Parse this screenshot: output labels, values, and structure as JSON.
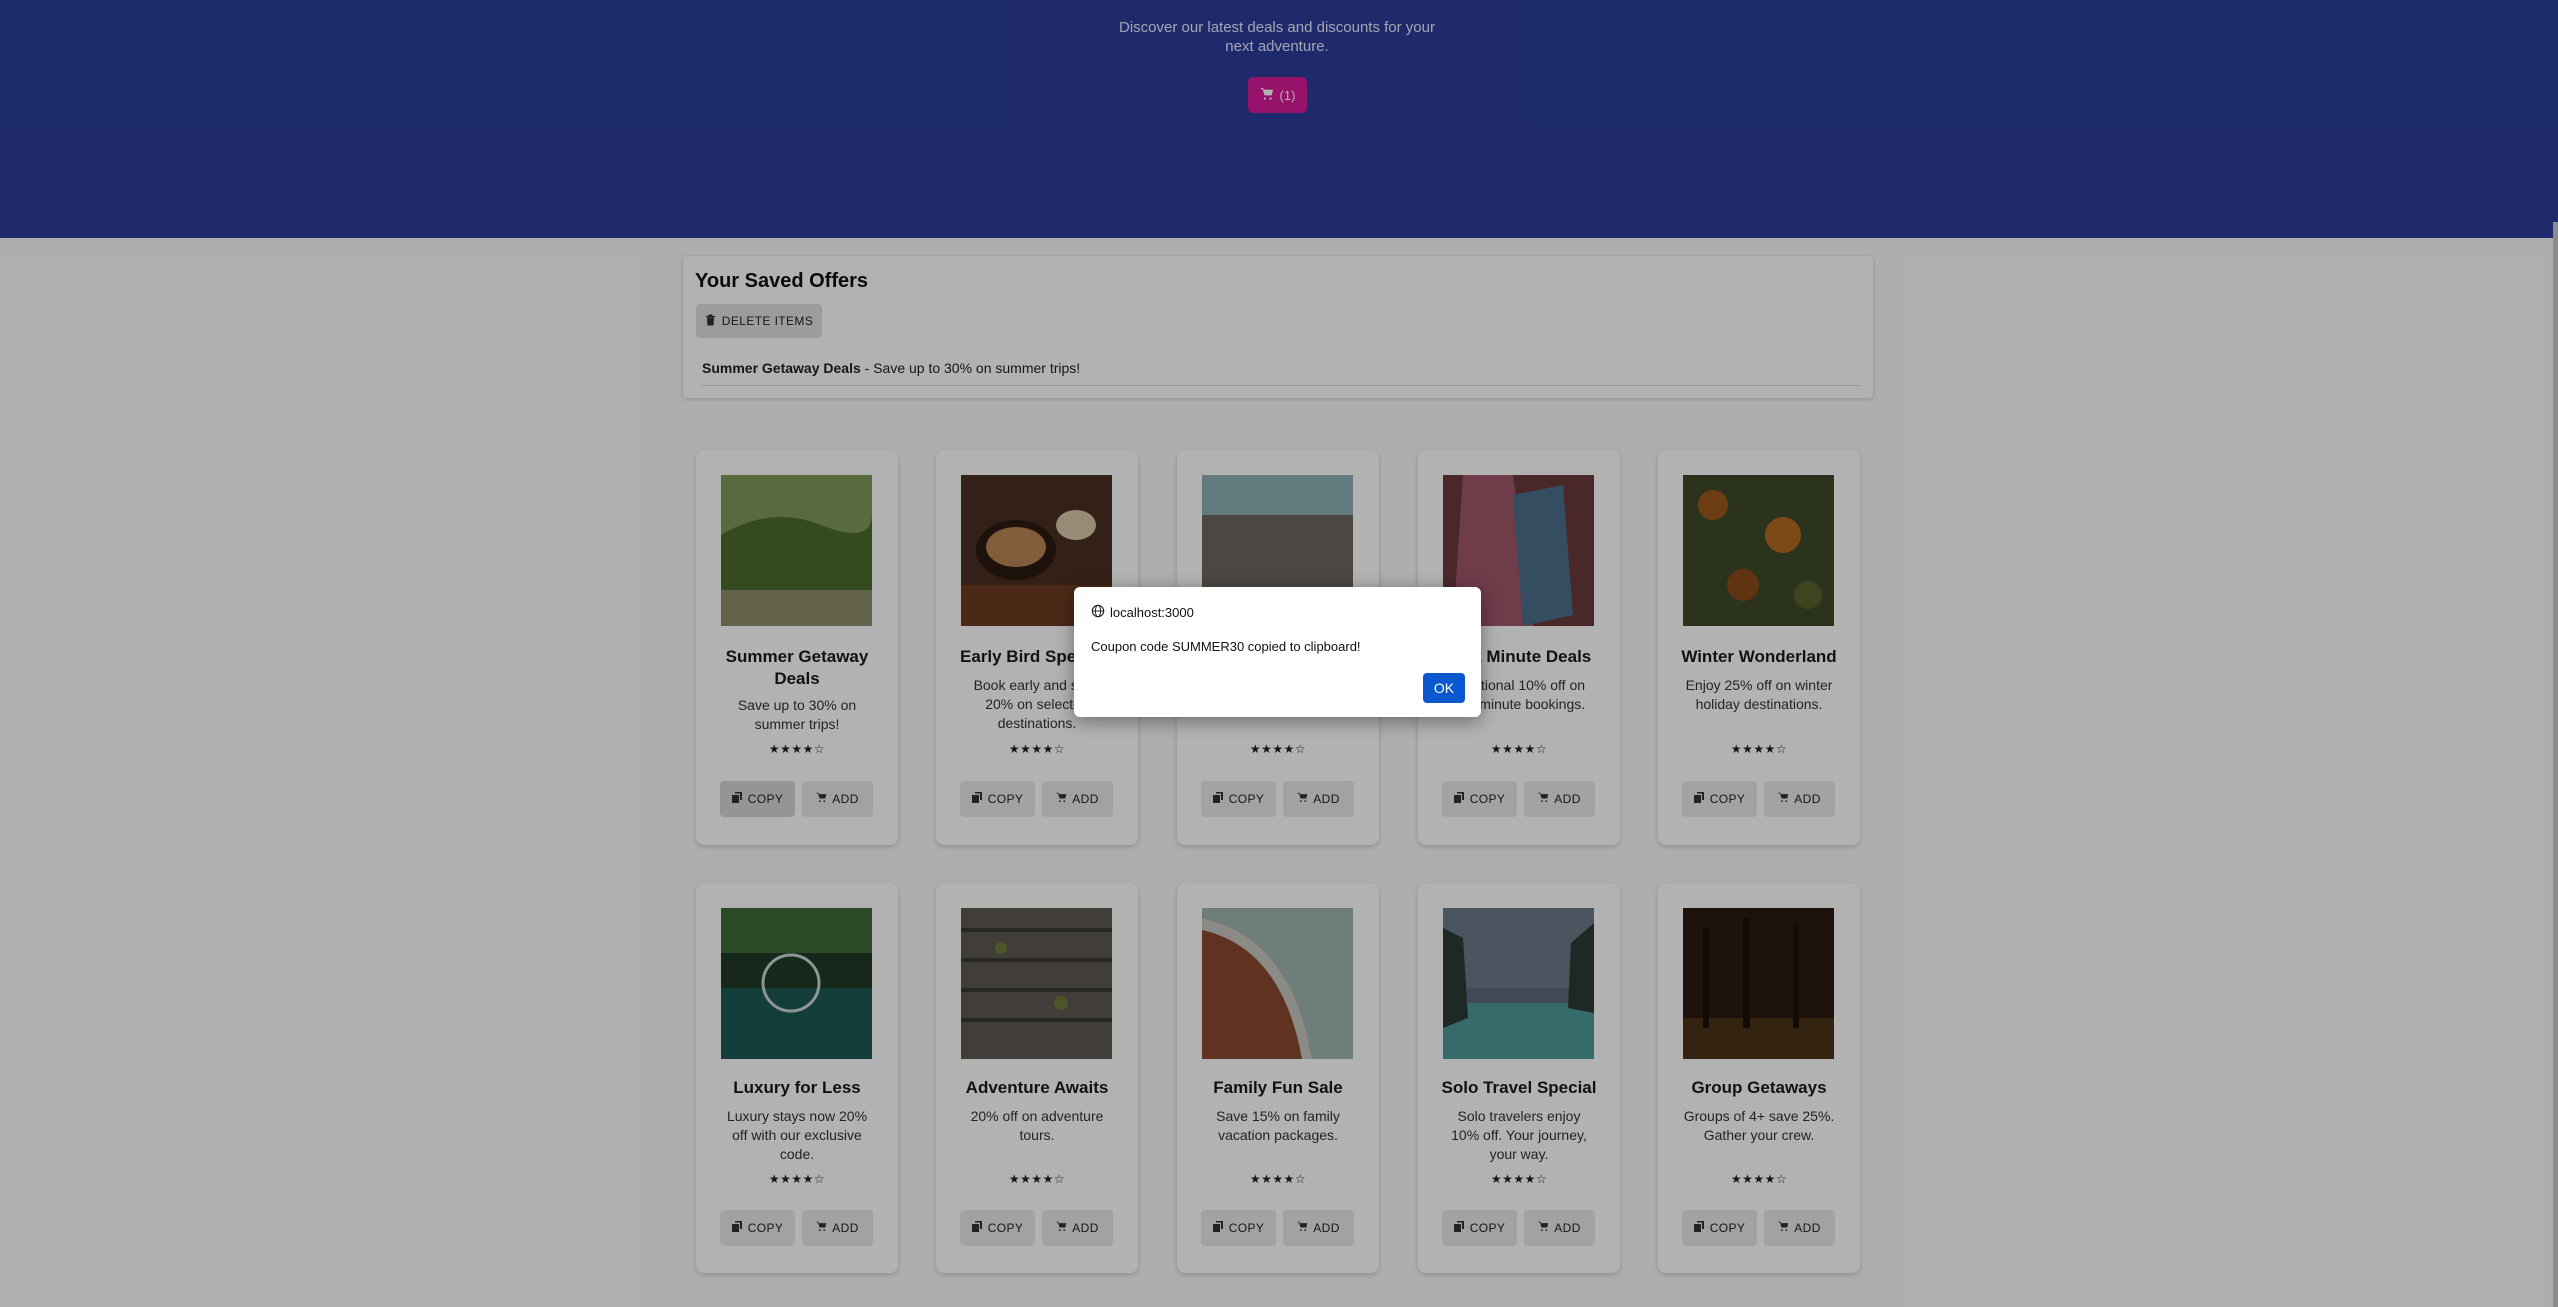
{
  "hero": {
    "subtitle": "Discover our latest deals and discounts for your next adventure.",
    "cart_label": "(1)",
    "cart_icon": "cart-icon",
    "background": "#2b3d9a",
    "cart_color": "#d81b9a"
  },
  "saved": {
    "title": "Your Saved Offers",
    "delete_label": "DELETE ITEMS",
    "item_name": "Summer Getaway Deals",
    "item_desc": " - Save up to 30% on summer trips!"
  },
  "card_buttons": {
    "copy": "COPY",
    "add": "ADD"
  },
  "cards": [
    {
      "title": "Summer Getaway Deals",
      "desc": "Save up to 30% on summer trips!",
      "stars": "★★★★☆",
      "rating": 4
    },
    {
      "title": "Early Bird Specials",
      "desc": "Book early and save 20% on selected destinations.",
      "stars": "★★★★☆",
      "rating": 4
    },
    {
      "title": "",
      "desc": "",
      "stars": "★★★★☆",
      "rating": 4
    },
    {
      "title": "Last Minute Deals",
      "desc": "Additional 10% off on last-minute bookings.",
      "stars": "★★★★☆",
      "rating": 4
    },
    {
      "title": "Winter Wonderland",
      "desc": "Enjoy 25% off on winter holiday destinations.",
      "stars": "★★★★☆",
      "rating": 4
    },
    {
      "title": "Luxury for Less",
      "desc": "Luxury stays now 20% off with our exclusive code.",
      "stars": "★★★★☆",
      "rating": 4
    },
    {
      "title": "Adventure Awaits",
      "desc": "20% off on adventure tours.",
      "stars": "★★★★☆",
      "rating": 4
    },
    {
      "title": "Family Fun Sale",
      "desc": "Save 15% on family vacation packages.",
      "stars": "★★★★☆",
      "rating": 4
    },
    {
      "title": "Solo Travel Special",
      "desc": "Solo travelers enjoy 10% off. Your journey, your way.",
      "stars": "★★★★☆",
      "rating": 4
    },
    {
      "title": "Group Getaways",
      "desc": "Groups of 4+ save 25%. Gather your crew.",
      "stars": "★★★★☆",
      "rating": 4
    }
  ],
  "dialog": {
    "origin": "localhost:3000",
    "message": "Coupon code SUMMER30 copied to clipboard!",
    "ok_label": "OK",
    "ok_color": "#0b57d0"
  }
}
